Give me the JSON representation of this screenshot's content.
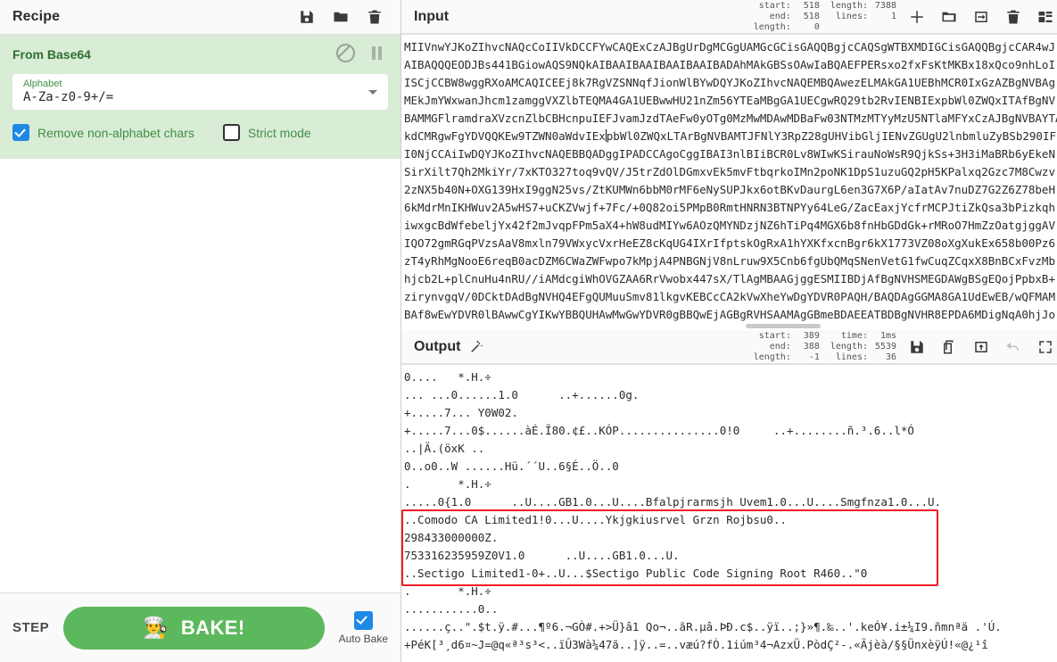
{
  "recipe": {
    "title": "Recipe",
    "icons": [
      {
        "name": "save-recipe-icon",
        "label": "Save recipe"
      },
      {
        "name": "load-recipe-icon",
        "label": "Load recipe"
      },
      {
        "name": "clear-recipe-icon",
        "label": "Clear recipe"
      }
    ],
    "operation": {
      "name": "From Base64",
      "disable_label": "Disable operation",
      "breakpoint_label": "Set breakpoint",
      "arg_label": "Alphabet",
      "arg_value": "A-Za-z0-9+/=",
      "checkbox_1": {
        "label": "Remove non-alphabet chars",
        "checked": true
      },
      "checkbox_2": {
        "label": "Strict mode",
        "checked": false
      }
    },
    "controls": {
      "step_label": "STEP",
      "bake_label": "BAKE!",
      "bake_emoji": "👨‍🍳",
      "auto_bake_label": "Auto Bake",
      "auto_bake_checked": true,
      "bake_color": "#5cb85c"
    }
  },
  "input": {
    "title": "Input",
    "meters": {
      "start_key": "start:",
      "start_value": "518",
      "end_key": "end:",
      "end_value": "518",
      "sel_length_key": "length:",
      "sel_length_value": "0",
      "length_key": "length:",
      "length_value": "7388",
      "lines_key": "lines:",
      "lines_value": "1"
    },
    "icons": [
      {
        "name": "add-input-tab-icon",
        "label": "Add a new input tab"
      },
      {
        "name": "open-folder-as-input-icon",
        "label": "Open folder as input"
      },
      {
        "name": "open-file-as-input-icon",
        "label": "Open file as input"
      },
      {
        "name": "clear-input-icon",
        "label": "Clear input and output"
      },
      {
        "name": "reset-pane-layout-icon",
        "label": "Reset pane layout"
      }
    ],
    "lines": [
      "MIIVnwYJKoZIhvcNAQcCoIIVkDCCFYwCAQExCzAJBgUrDgMCGgUAMGcGCisGAQQBgjcCAQSgWTBXMDIGCisGAQQBgjcCAR4wJ",
      "AIBAQQQEODJBs441BGiowAQS9NQkAIBAAIBAAIBAAIBAAIBADAhMAkGBSsOAwIaBQAEFPERsxo2fxFsKtMKBx18xQco9nhLoI",
      "ISCjCCBW8wggRXoAMCAQICEEj8k7RgVZSNNqfJionWlBYwDQYJKoZIhvcNAQEMBQAwezELMAkGA1UEBhMCR0IxGzAZBgNVBAg",
      "MEkJmYWxwanJhcm1zamggVXZlbTEQMA4GA1UEBwwHU21nZm56YTEaMBgGA1UECgwRQ29tb2RvIENBIExpbWl0ZWQxITAfBgNV",
      "BAMMGFlramdraXVzcnZlbCBHcnpuIEFJvamJzdTAeFw0yOTg0MzMwMDAwMDBaFw03NTMzMTYyMzU5NTlaMFYxCzAJBgNVBAYTA",
      "kdCMRgwFgYDVQQKEw9TZWN0aWdvIExpbWl0ZWQxLTArBgNVBAMTJFNlY3RpZ28gUHVibGljIENvZGUgU2lnbmluZyBSb290IF",
      "I0NjCCAiIwDQYJKoZIhvcNAQEBBQADggIPADCCAgoCggIBAI3nlBIiBCR0Lv8WIwKSirauNoWsR9QjkSs+3H3iMaBRb6yEkeN",
      "SirXilt7Qh2MkiYr/7xKTO327toq9vQV/J5trZdOlDGmxvEk5mvFtbqrkoIMn2poNK1DpS1uzuGQ2pH5KPalxq2Gzc7M8Cwzv",
      "2zNX5b40N+OXG139HxI9ggN25vs/ZtKUMWn6bbM0rMF6eNySUPJkx6otBKvDaurgL6en3G7X6P/aIatAv7nuDZ7G2Z6Z78beH",
      "6kMdrMnIKHWuv2A5wHS7+uCKZVwjf+7Fc/+0Q82oi5PMpB0RmtHNRN3BTNPYy64LeG/ZacEaxjYcfrMCPJtiZkQsa3bPizkqh",
      "iwxgcBdWfebeljYx42f2mJvqpFPm5aX4+hW8udMIYw6AOzQMYNDzjNZ6hTiPq4MGX6b8fnHbGDdGk+rMRoO7HmZzOatgjggAV",
      "IQO72gmRGqPVzsAaV8mxln79VWxycVxrHeEZ8cKqUG4IXrIfptskOgRxA1hYXKfxcnBgr6kX1773VZ08oXgXukEx658b00Pz6",
      "zT4yRhMgNooE6reqB0acDZM6CWaZWFwpo7kMpjA4PNBGNjV8nLruw9X5Cnb6fgUbQMqSNenVetG1fwCuqZCqxX8BnBCxFvzMb",
      "hjcb2L+plCnuHu4nRU//iAMdcgiWhOVGZAA6RrVwobx447sX/TlAgMBAAGjggESMIIBDjAfBgNVHSMEGDAWgBSgEQojPpbxB+",
      "zirynvgqV/0DCktDAdBgNVHQ4EFgQUMuuSmv81lkgvKEBCcCA2kVwXheYwDgYDVR0PAQH/BAQDAgGGMA8GA1UdEwEB/wQFMAM",
      "BAf8wEwYDVR0lBAwwCgYIKwYBBQUHAwMwGwYDVR0gBBQwEjAGBgRVHSAAMAgGBmeBDAEEATBDBgNVHR8EPDA6MDigNqA0hjJo"
    ]
  },
  "output": {
    "title": "Output",
    "magic_icon": "magic-wand-icon",
    "meters": {
      "start_key": "start:",
      "start_value": "389",
      "end_key": "end:",
      "end_value": "388",
      "sel_length_key": "length:",
      "sel_length_value": "-1",
      "time_key": "time:",
      "time_value": "1ms",
      "length_key": "length:",
      "length_value": "5539",
      "lines_key": "lines:",
      "lines_value": "36"
    },
    "icons": [
      {
        "name": "save-output-icon",
        "label": "Save output to file"
      },
      {
        "name": "copy-output-icon",
        "label": "Copy raw output to the clipboard"
      },
      {
        "name": "replace-input-icon",
        "label": "Replace input with output"
      },
      {
        "name": "undo-icon",
        "label": "Undo",
        "disabled": true
      },
      {
        "name": "maximise-output-icon",
        "label": "Maximise output pane"
      }
    ],
    "lines": [
      "0....   *.H.÷",
      "... ...0......1.0      ..+......0g.",
      "+.....7... Y0W02.",
      "+.....7...0$......àÉ.Ĩ80.¢£..KÓP...............0!0     ..+........ñ.³.6..l*Ó",
      "..|Ä.(öxK ..",
      "0..o0..W ......Hü.´´U..6§É..Ö..0",
      ".       *.H.÷",
      ".....0{1.0      ..U....GB1.0...U....Bfalpjrarmsjh Uvem1.0...U....Smgfnza1.0...U.",
      "..Comodo CA Limited1!0...U....Ykjgkiusrvel Grzn Rojbsu0..",
      "298433000000Z.",
      "753316235959Z0V1.0      ..U....GB1.0...U.",
      "..Sectigo Limited1-0+..U...$Sectigo Public Code Signing Root R460..\"0",
      ".       *.H.÷",
      "...........0..",
      "......ç..\".$t.ÿ.#...¶º6.¬GÒ#.+>Ü}â1 Qo¬..ãR.µâ.ÞÐ.c$..ÿï..;}»¶.‰..'.keÓ¥.i±¼I9.ñmnªä .'Ú.",
      "+PéK[³¸d6¤~J=@q«ª³s³<..ïÛ3Wà¼47ã..]ÿ..=..væú?fÒ.1iúm³4¬AzxÜ.PòdÇ²-.«Ãjèà/§§ÜnxèÿÚ!«@¿¹î"
    ],
    "highlight_color": "#ee1c25",
    "highlight_start_line": 8,
    "highlight_end_line": 11
  }
}
